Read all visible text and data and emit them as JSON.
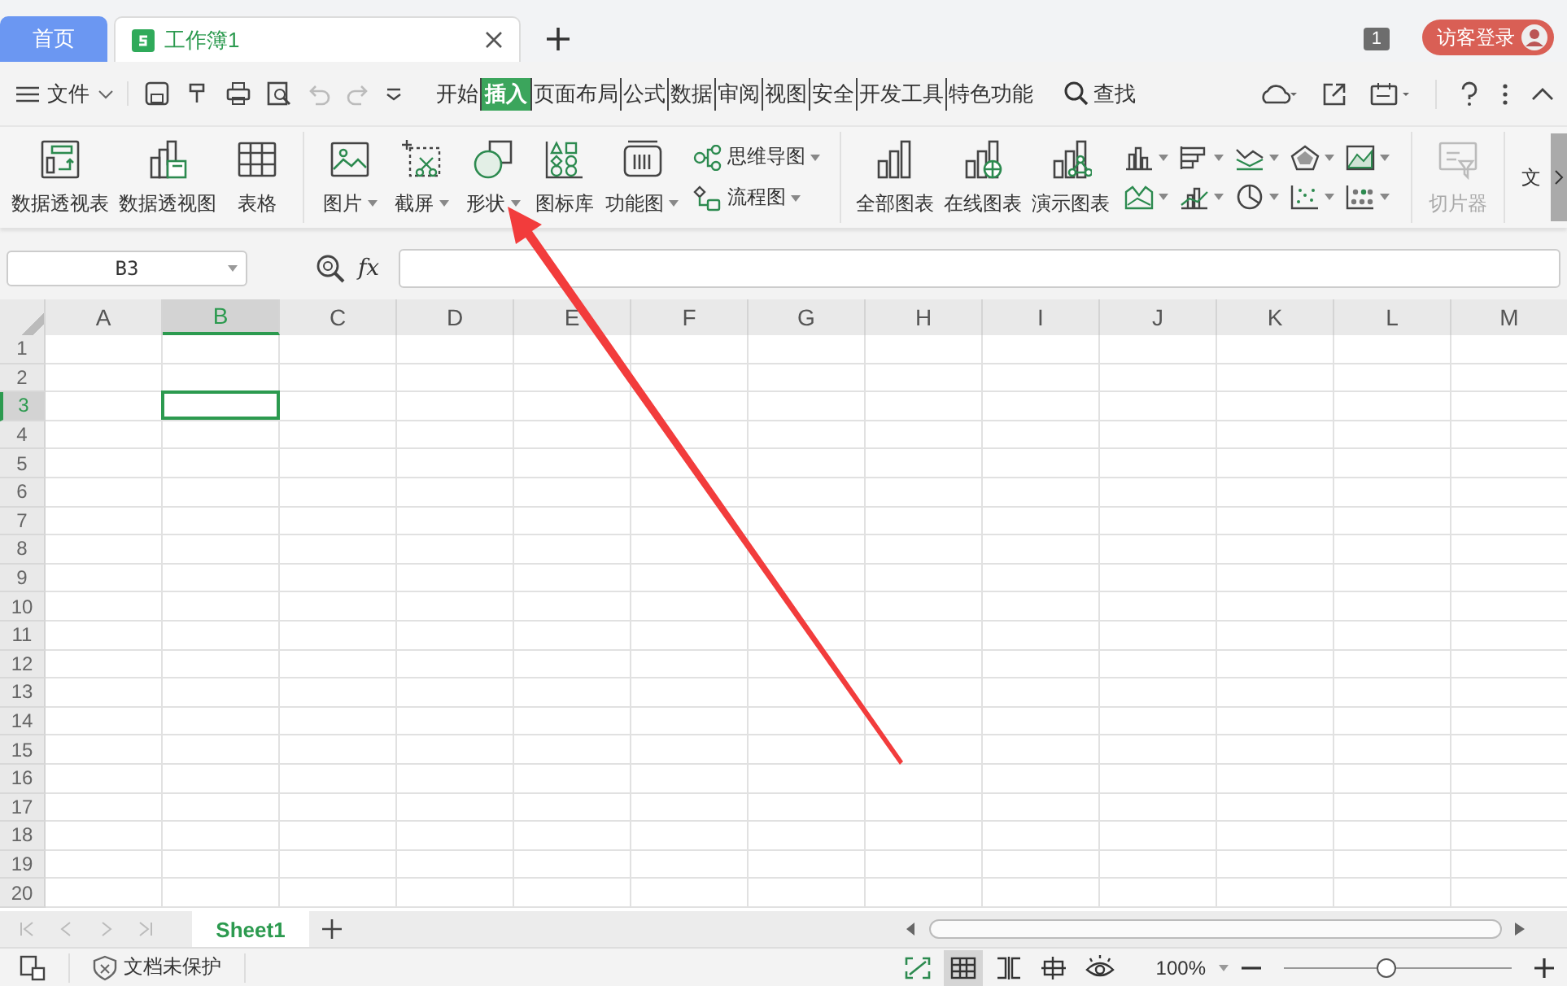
{
  "tabs": [
    {
      "label": "首页",
      "kind": "home",
      "selected": false
    },
    {
      "label": "工作簿1",
      "kind": "doc",
      "selected": true
    }
  ],
  "account": {
    "count": "1",
    "login": "访客登录"
  },
  "menu": {
    "file": "文件",
    "tabs": [
      {
        "label": "开始",
        "selected": false
      },
      {
        "label": "插入",
        "selected": true
      },
      {
        "label": "页面布局",
        "selected": false
      },
      {
        "label": "公式",
        "selected": false
      },
      {
        "label": "数据",
        "selected": false
      },
      {
        "label": "审阅",
        "selected": false
      },
      {
        "label": "视图",
        "selected": false
      },
      {
        "label": "安全",
        "selected": false
      },
      {
        "label": "开发工具",
        "selected": false
      },
      {
        "label": "特色功能",
        "selected": false
      }
    ],
    "search": "查找"
  },
  "ribbon": {
    "items": [
      {
        "kind": "big",
        "label": "数据透视表",
        "dropdown": false
      },
      {
        "kind": "big",
        "label": "数据透视图",
        "dropdown": false
      },
      {
        "kind": "big",
        "label": "表格",
        "dropdown": false
      },
      {
        "kind": "sep"
      },
      {
        "kind": "big",
        "label": "图片",
        "dropdown": true
      },
      {
        "kind": "big",
        "label": "截屏",
        "dropdown": true
      },
      {
        "kind": "big",
        "label": "形状",
        "dropdown": true
      },
      {
        "kind": "big",
        "label": "图标库",
        "dropdown": false
      },
      {
        "kind": "big",
        "label": "功能图",
        "dropdown": true
      },
      {
        "kind": "stack",
        "items": [
          {
            "label": "思维导图",
            "dropdown": true
          },
          {
            "label": "流程图",
            "dropdown": true
          }
        ]
      },
      {
        "kind": "sep"
      },
      {
        "kind": "big",
        "label": "全部图表",
        "dropdown": false
      },
      {
        "kind": "big",
        "label": "在线图表",
        "dropdown": false
      },
      {
        "kind": "big",
        "label": "演示图表",
        "dropdown": false
      },
      {
        "kind": "charts"
      },
      {
        "kind": "sep"
      },
      {
        "kind": "big",
        "label": "切片器",
        "dropdown": false,
        "disabled": true
      },
      {
        "kind": "sep"
      },
      {
        "kind": "cut",
        "label": "文"
      }
    ]
  },
  "formula_bar": {
    "cell_ref": "B3",
    "fx": "fx"
  },
  "sheet": {
    "columns": [
      {
        "label": "A",
        "selected": false
      },
      {
        "label": "B",
        "selected": true
      },
      {
        "label": "C",
        "selected": false
      },
      {
        "label": "D",
        "selected": false
      },
      {
        "label": "E",
        "selected": false
      },
      {
        "label": "F",
        "selected": false
      },
      {
        "label": "G",
        "selected": false
      },
      {
        "label": "H",
        "selected": false
      },
      {
        "label": "I",
        "selected": false
      },
      {
        "label": "J",
        "selected": false
      },
      {
        "label": "K",
        "selected": false
      },
      {
        "label": "L",
        "selected": false
      },
      {
        "label": "M",
        "selected": false
      }
    ],
    "rows": [
      {
        "label": "1",
        "selected": false
      },
      {
        "label": "2",
        "selected": false
      },
      {
        "label": "3",
        "selected": true
      },
      {
        "label": "4",
        "selected": false
      },
      {
        "label": "5",
        "selected": false
      },
      {
        "label": "6",
        "selected": false
      },
      {
        "label": "7",
        "selected": false
      },
      {
        "label": "8",
        "selected": false
      },
      {
        "label": "9",
        "selected": false
      },
      {
        "label": "10",
        "selected": false
      },
      {
        "label": "11",
        "selected": false
      },
      {
        "label": "12",
        "selected": false
      },
      {
        "label": "13",
        "selected": false
      },
      {
        "label": "14",
        "selected": false
      },
      {
        "label": "15",
        "selected": false
      },
      {
        "label": "16",
        "selected": false
      },
      {
        "label": "17",
        "selected": false
      },
      {
        "label": "18",
        "selected": false
      },
      {
        "label": "19",
        "selected": false
      },
      {
        "label": "20",
        "selected": false
      }
    ]
  },
  "sheet_tabs": [
    {
      "label": "Sheet1",
      "selected": true
    }
  ],
  "status_bar": {
    "protection": "文档未保护",
    "views": [
      {
        "kind": "fullscreen",
        "selected": false
      },
      {
        "kind": "normal",
        "selected": true
      },
      {
        "kind": "page-break",
        "selected": false
      },
      {
        "kind": "layout",
        "selected": false
      },
      {
        "kind": "eye",
        "selected": false
      }
    ],
    "zoom": "100%",
    "zoom_slider": {
      "level": 0.45
    }
  }
}
